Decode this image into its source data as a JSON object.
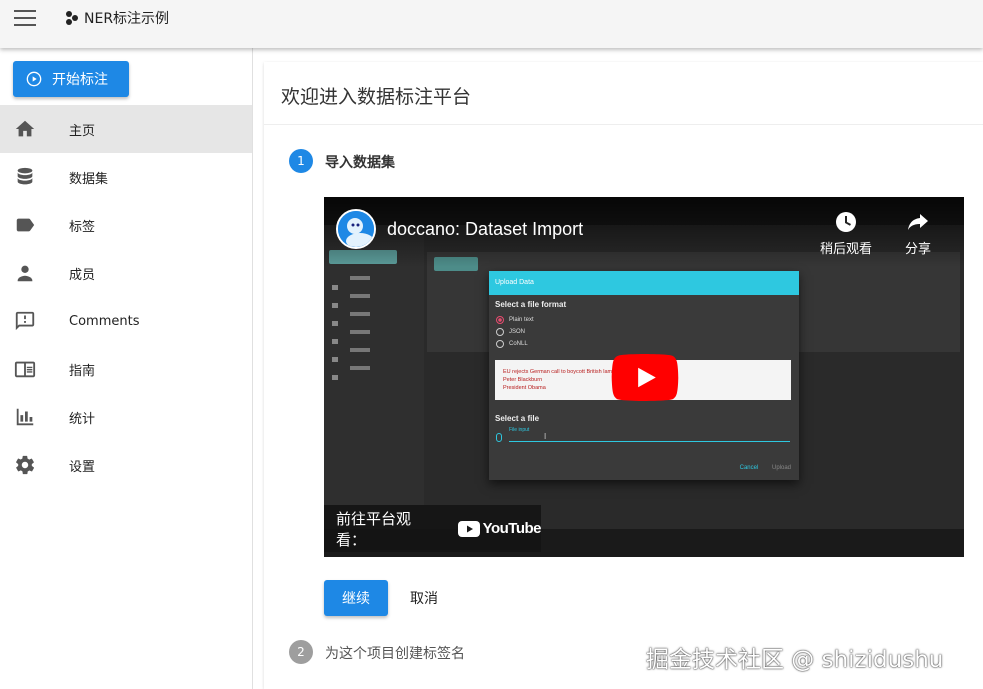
{
  "appbar": {
    "brand": "NER标注示例"
  },
  "sidebar": {
    "start_label": "开始标注",
    "items": [
      {
        "label": "主页",
        "icon": "home-icon",
        "active": true
      },
      {
        "label": "数据集",
        "icon": "database-icon"
      },
      {
        "label": "标签",
        "icon": "label-icon"
      },
      {
        "label": "成员",
        "icon": "person-icon"
      },
      {
        "label": "Comments",
        "icon": "comment-icon"
      },
      {
        "label": "指南",
        "icon": "book-icon"
      },
      {
        "label": "统计",
        "icon": "chart-icon"
      },
      {
        "label": "设置",
        "icon": "gear-icon"
      }
    ]
  },
  "main": {
    "title": "欢迎进入数据标注平台",
    "step1": {
      "num": "1",
      "label": "导入数据集"
    },
    "step2": {
      "num": "2",
      "label": "为这个项目创建标签名"
    },
    "continue_label": "继续",
    "cancel_label": "取消"
  },
  "video": {
    "title": "doccano: Dataset Import",
    "watch_later": "稍后观看",
    "share": "分享",
    "watch_on": "前往平台观看：",
    "youtube": "YouTube",
    "dialog": {
      "header": "Upload Data",
      "format_heading": "Select a file format",
      "formats": [
        "Plain text",
        "JSON",
        "CoNLL"
      ],
      "sample_lines": [
        "EU rejects German call to boycott British lamb.",
        "Peter Blackburn",
        "President Obama"
      ],
      "file_heading": "Select a file",
      "file_hint": "File input",
      "cancel": "Cancel",
      "upload": "Upload"
    }
  },
  "watermark": "掘金技术社区 @ shizidushu",
  "colors": {
    "primary": "#1e88e5",
    "step_inactive": "#9e9e9e",
    "youtube_red": "#ff0000"
  }
}
